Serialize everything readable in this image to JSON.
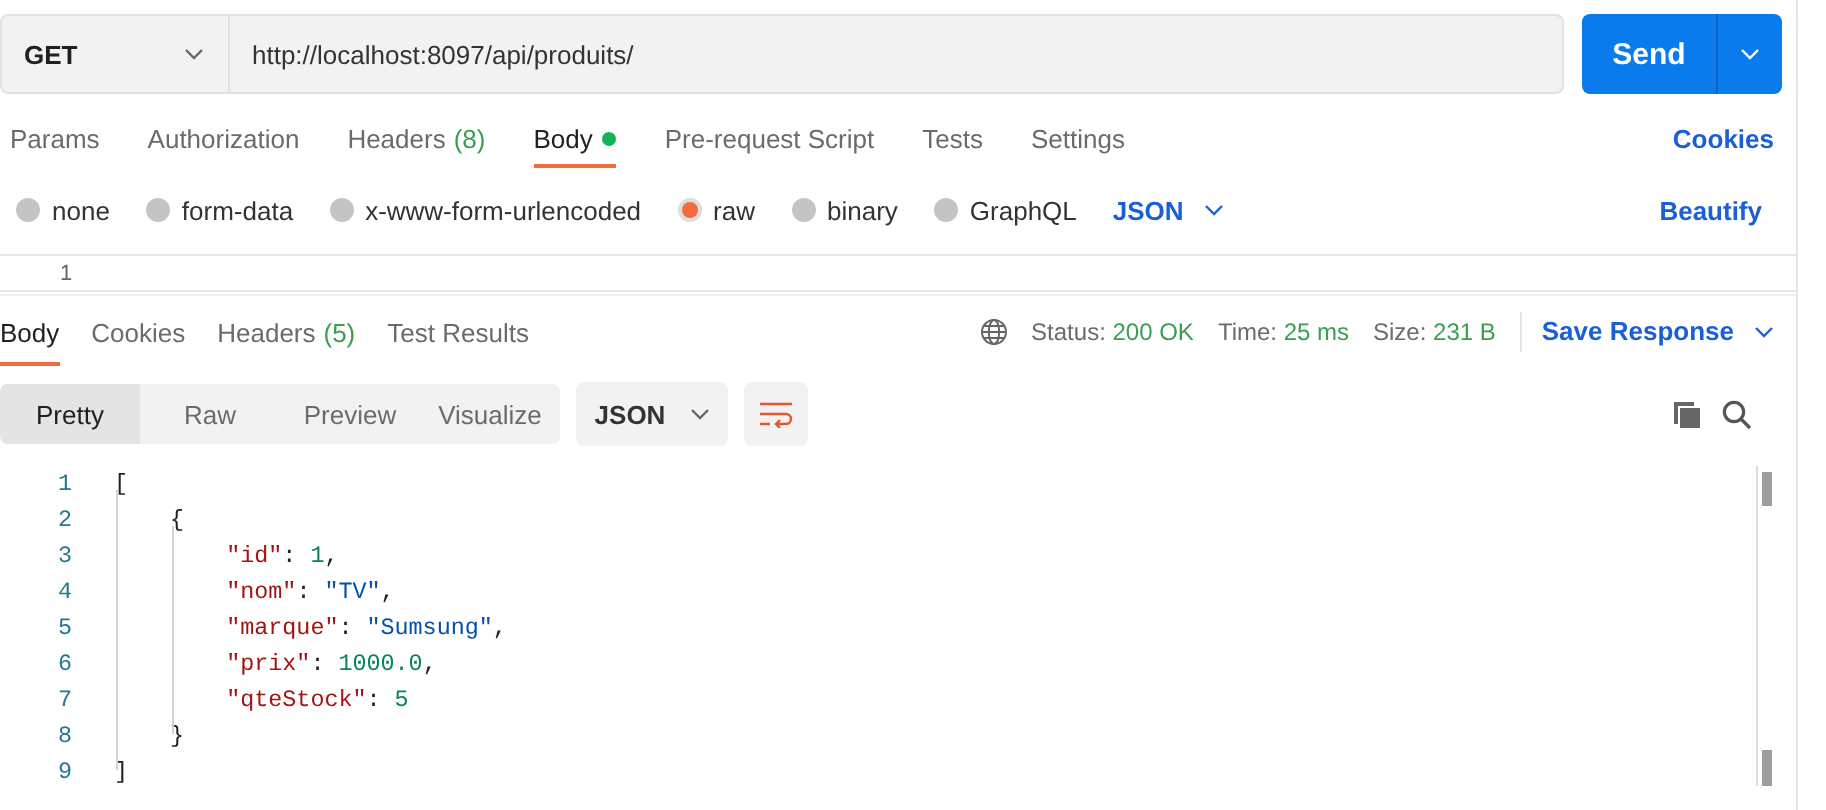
{
  "request": {
    "method": "GET",
    "url": "http://localhost:8097/api/produits/",
    "send": "Send"
  },
  "request_tabs": [
    {
      "label": "Params",
      "selected": false
    },
    {
      "label": "Authorization",
      "selected": false
    },
    {
      "label": "Headers",
      "count": "(8)",
      "selected": false
    },
    {
      "label": "Body",
      "selected": true,
      "has_content": true
    },
    {
      "label": "Pre-request Script",
      "selected": false
    },
    {
      "label": "Tests",
      "selected": false
    },
    {
      "label": "Settings",
      "selected": false
    }
  ],
  "cookies": "Cookies",
  "body_types": [
    {
      "label": "none",
      "selected": false
    },
    {
      "label": "form-data",
      "selected": false
    },
    {
      "label": "x-www-form-urlencoded",
      "selected": false
    },
    {
      "label": "raw",
      "selected": true
    },
    {
      "label": "binary",
      "selected": false
    },
    {
      "label": "GraphQL",
      "selected": false
    }
  ],
  "body_format": "JSON",
  "beautify": "Beautify",
  "request_editor": {
    "line_numbers": [
      "1"
    ]
  },
  "response_tabs": [
    {
      "label": "Body",
      "selected": true
    },
    {
      "label": "Cookies",
      "selected": false
    },
    {
      "label": "Headers",
      "count": "(5)",
      "selected": false
    },
    {
      "label": "Test Results",
      "selected": false
    }
  ],
  "status": [
    {
      "label": "Status:",
      "value": "200 OK"
    },
    {
      "label": "Time:",
      "value": "25 ms"
    },
    {
      "label": "Size:",
      "value": "231 B"
    }
  ],
  "save_response": "Save Response",
  "view_modes": [
    {
      "label": "Pretty",
      "selected": true
    },
    {
      "label": "Raw",
      "selected": false
    },
    {
      "label": "Preview",
      "selected": false
    },
    {
      "label": "Visualize",
      "selected": false
    }
  ],
  "response_format": "JSON",
  "code_lines": [
    {
      "number": "1",
      "tokens": [
        {
          "kind": "punct",
          "text": "["
        }
      ]
    },
    {
      "number": "2",
      "tokens": [
        {
          "kind": "punct",
          "text": "    {"
        }
      ]
    },
    {
      "number": "3",
      "tokens": [
        {
          "kind": "key",
          "text": "        \"id\""
        },
        {
          "kind": "punct",
          "text": ": "
        },
        {
          "kind": "number",
          "text": "1"
        },
        {
          "kind": "punct",
          "text": ","
        }
      ]
    },
    {
      "number": "4",
      "tokens": [
        {
          "kind": "key",
          "text": "        \"nom\""
        },
        {
          "kind": "punct",
          "text": ": "
        },
        {
          "kind": "string",
          "text": "\"TV\""
        },
        {
          "kind": "punct",
          "text": ","
        }
      ]
    },
    {
      "number": "5",
      "tokens": [
        {
          "kind": "key",
          "text": "        \"marque\""
        },
        {
          "kind": "punct",
          "text": ": "
        },
        {
          "kind": "string",
          "text": "\"Sumsung\""
        },
        {
          "kind": "punct",
          "text": ","
        }
      ]
    },
    {
      "number": "6",
      "tokens": [
        {
          "kind": "key",
          "text": "        \"prix\""
        },
        {
          "kind": "punct",
          "text": ": "
        },
        {
          "kind": "number",
          "text": "1000.0"
        },
        {
          "kind": "punct",
          "text": ","
        }
      ]
    },
    {
      "number": "7",
      "tokens": [
        {
          "kind": "key",
          "text": "        \"qteStock\""
        },
        {
          "kind": "punct",
          "text": ": "
        },
        {
          "kind": "number",
          "text": "5"
        }
      ]
    },
    {
      "number": "8",
      "tokens": [
        {
          "kind": "punct",
          "text": "    }"
        }
      ]
    },
    {
      "number": "9",
      "tokens": [
        {
          "kind": "punct",
          "text": "]"
        }
      ]
    }
  ]
}
